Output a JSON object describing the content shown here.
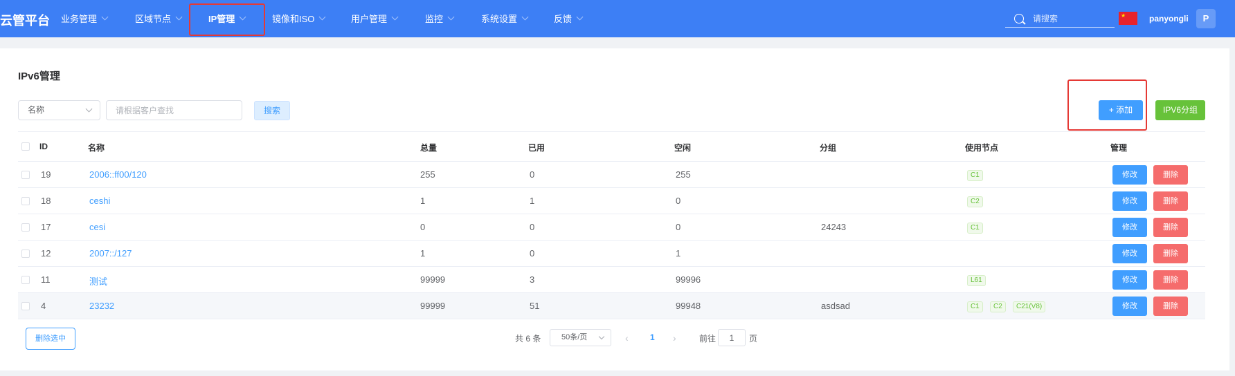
{
  "brand": "云管平台",
  "nav": [
    {
      "label": "业务管理"
    },
    {
      "label": "区域节点"
    },
    {
      "label": "IP管理",
      "active": true
    },
    {
      "label": "镜像和ISO"
    },
    {
      "label": "用户管理"
    },
    {
      "label": "监控"
    },
    {
      "label": "系统设置"
    },
    {
      "label": "反馈"
    }
  ],
  "header": {
    "search_placeholder": "请搜索",
    "flag_icon": "china-flag-icon",
    "username": "panyongli",
    "avatar_initial": "P"
  },
  "page": {
    "title": "IPv6管理"
  },
  "filter": {
    "field_select": "名称",
    "input_placeholder": "请根据客户查找",
    "search_button": "搜索"
  },
  "actions": {
    "add_button": "+ 添加",
    "group_button": "IPV6分组"
  },
  "table": {
    "headers": {
      "id": "ID",
      "name": "名称",
      "total": "总量",
      "used": "已用",
      "free": "空闲",
      "group": "分组",
      "nodes": "使用节点",
      "manage": "管理"
    },
    "edit_label": "修改",
    "delete_label": "删除",
    "rows": [
      {
        "id": "19",
        "name": "2006::ff00/120",
        "total": "255",
        "used": "0",
        "free": "255",
        "group": "",
        "nodes": [
          "C1"
        ]
      },
      {
        "id": "18",
        "name": "ceshi",
        "total": "1",
        "used": "1",
        "free": "0",
        "group": "",
        "nodes": [
          "C2"
        ]
      },
      {
        "id": "17",
        "name": "cesi",
        "total": "0",
        "used": "0",
        "free": "0",
        "group": "24243",
        "nodes": [
          "C1"
        ]
      },
      {
        "id": "12",
        "name": "2007::/127",
        "total": "1",
        "used": "0",
        "free": "1",
        "group": "",
        "nodes": []
      },
      {
        "id": "11",
        "name": "测试",
        "total": "99999",
        "used": "3",
        "free": "99996",
        "group": "",
        "nodes": [
          "L61"
        ]
      },
      {
        "id": "4",
        "name": "23232",
        "total": "99999",
        "used": "51",
        "free": "99948",
        "group": "asdsad",
        "nodes": [
          "C1",
          "C2",
          "C21(V8)"
        ]
      }
    ]
  },
  "footer": {
    "delete_selected": "删除选中",
    "total_text": "共 6 条",
    "page_size": "50条/页",
    "current_page": "1",
    "goto_label": "前往",
    "goto_value": "1",
    "page_suffix": "页"
  },
  "colors": {
    "header_bg": "#3d7ff5",
    "primary": "#409eff",
    "success": "#67c23a",
    "danger": "#f56c6c",
    "highlight_box": "#e53935"
  }
}
